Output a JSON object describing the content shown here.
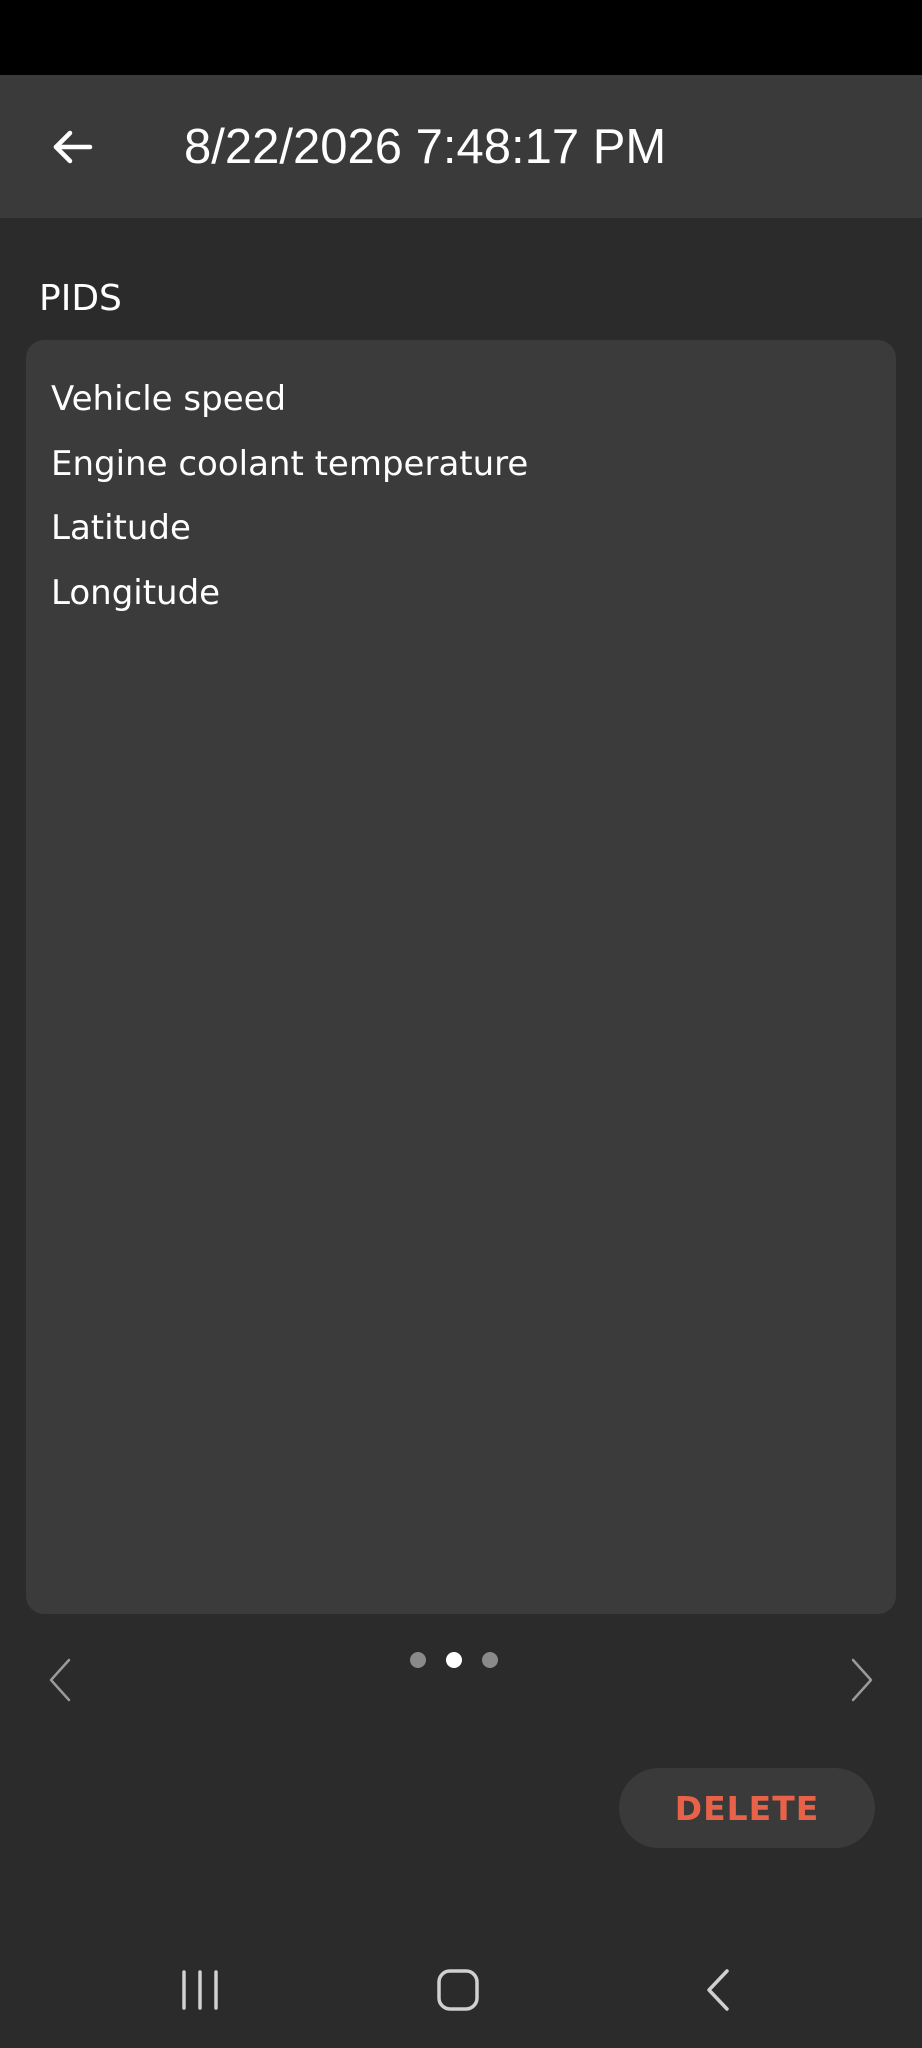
{
  "app_bar": {
    "title": "8/22/2026 7:48:17 PM",
    "back_icon": "arrow-left-icon"
  },
  "section": {
    "label": "PIDS"
  },
  "pids": [
    "Vehicle speed",
    "Engine coolant temperature",
    "Latitude",
    "Longitude"
  ],
  "pager": {
    "prev_icon": "chevron-left-icon",
    "next_icon": "chevron-right-icon",
    "page_count": 3,
    "active_page": 2
  },
  "actions": {
    "delete_label": "DELETE"
  },
  "colors": {
    "background": "#2b2b2b",
    "app_bar": "#3a3a3a",
    "card": "#3b3b3b",
    "delete_text": "#e8624a",
    "dot_active": "#ffffff",
    "dot_inactive": "#8a8a8a"
  },
  "system_nav": {
    "recents_icon": "recents-icon",
    "home_icon": "home-icon",
    "back_icon": "back-icon"
  }
}
